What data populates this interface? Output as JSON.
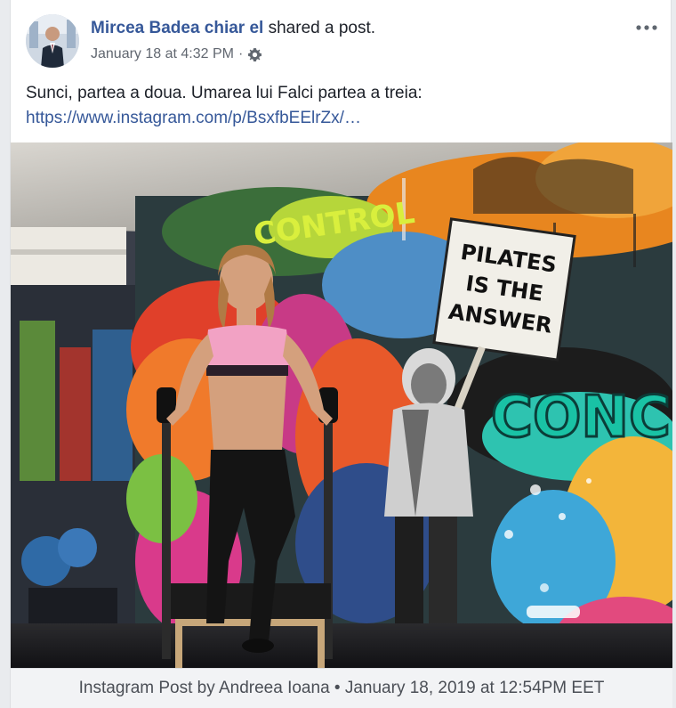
{
  "post": {
    "author_name": "Mircea Badea chiar el",
    "action_text": " shared a post.",
    "timestamp": "January 18 at 4:32 PM",
    "separator": " · ",
    "privacy_icon": "gear-icon",
    "more_icon": "more-options-icon",
    "message": "Sunci, partea a doua. Umarea lui Falci partea a treia:",
    "link_text": "https://www.instagram.com/p/BsxfbEElrZx/…"
  },
  "photo": {
    "sign_text_line1": "PILATES",
    "sign_text_line2": "IS THE",
    "sign_text_line3": "ANSWER",
    "graffiti_word_control": "CONTROL",
    "graffiti_word_conce": "CONCE"
  },
  "attachment": {
    "caption": "Instagram Post by Andreea Ioana • January 18, 2019 at 12:54PM EET"
  },
  "colors": {
    "link": "#365899",
    "text": "#1d2129",
    "meta": "#616770",
    "background": "#e9ebee"
  }
}
